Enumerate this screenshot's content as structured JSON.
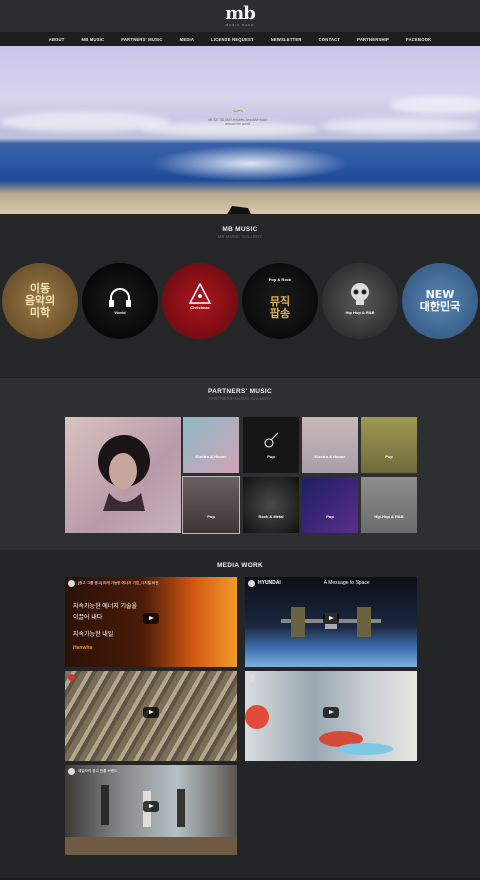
{
  "header": {
    "logo_mark": "mb",
    "logo_sub": "MUSIC BAND"
  },
  "nav": [
    "ABOUT",
    "MB MUSIC",
    "PARTNERS' MUSIC",
    "MEDIA",
    "LICENSE REQUEST",
    "NEWSLETTER",
    "CONTACT",
    "PARTNERSHIP",
    "FACEBOOK"
  ],
  "hero": {
    "caption_line1": "MUSIC ISLAND includes beautiful music",
    "caption_line2": "around the world."
  },
  "music": {
    "title": "MB MUSIC",
    "subtitle": "MB MUSIC GALLERY",
    "genres": [
      {
        "label": "",
        "text": "이동\n음악의\n미학"
      },
      {
        "label": "World",
        "text": ""
      },
      {
        "label": "Christmas",
        "text": ""
      },
      {
        "label": "Pop & Rock",
        "text": "뮤직\n팝송"
      },
      {
        "label": "Hip Hop & R&B",
        "text": ""
      },
      {
        "label": "",
        "text": "NEW\n대한민국"
      }
    ]
  },
  "partners": {
    "title": "PARTNERS' MUSIC",
    "subtitle": "PARTNERS' MUSIC GALLERY",
    "tiles": [
      "",
      "Electro & House",
      "Pop",
      "Electro & House",
      "Pop",
      "Pop",
      "Rock & Metal",
      "Pop",
      "Hip-Hop & R&B"
    ]
  },
  "media": {
    "title": "MEDIA WORK",
    "videos": [
      {
        "title": "[광고·그룹 광고] 미래 가능한 에너지 기업_디지털 버전",
        "overlay1": "지속가능한 에너지 기술을",
        "overlay2": "이끌어 내다",
        "overlay3": "지속가능한 내일",
        "brand": "Hanwha"
      },
      {
        "title": "HYUNDAI",
        "overlay1": "A Message to Space",
        "overlay2": "",
        "overlay3": "",
        "brand": ""
      },
      {
        "title": "",
        "overlay1": "",
        "overlay2": "",
        "overlay3": "",
        "brand": ""
      },
      {
        "title": "",
        "overlay1": "",
        "overlay2": "",
        "overlay3": "",
        "brand": ""
      },
      {
        "title": "제일모직 광고 빈폴 브랜드",
        "overlay1": "",
        "overlay2": "",
        "overlay3": "",
        "brand": ""
      }
    ]
  },
  "colors": {
    "bg": "#262729",
    "nav": "#1d1e20",
    "accent": "#c9a24d"
  }
}
